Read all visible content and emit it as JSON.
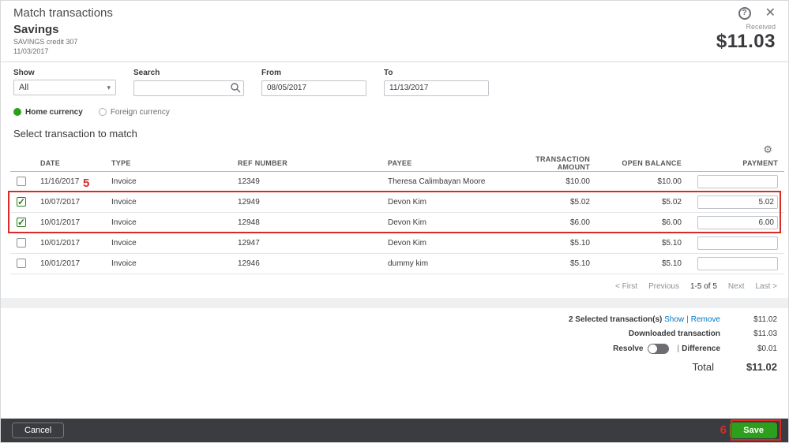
{
  "icons": {
    "help": "?",
    "close": "✕",
    "gear": "⚙",
    "caret": "▾"
  },
  "header": {
    "title": "Match transactions"
  },
  "account": {
    "name": "Savings",
    "subtitle": "SAVINGS credit 307",
    "date": "11/03/2017",
    "received_label": "Received",
    "received_amount": "$11.03"
  },
  "filters": {
    "show_label": "Show",
    "show_value": "All",
    "search_label": "Search",
    "search_value": "",
    "from_label": "From",
    "from_value": "08/05/2017",
    "to_label": "To",
    "to_value": "11/13/2017"
  },
  "currency": {
    "home_label": "Home currency",
    "foreign_label": "Foreign currency",
    "selected": "home"
  },
  "section_title": "Select transaction to match",
  "table": {
    "columns": [
      "DATE",
      "TYPE",
      "REF NUMBER",
      "PAYEE",
      "TRANSACTION AMOUNT",
      "OPEN BALANCE",
      "PAYMENT"
    ],
    "rows": [
      {
        "checked": false,
        "date": "11/16/2017",
        "type": "Invoice",
        "ref": "12349",
        "payee": "Theresa Calimbayan Moore",
        "amount": "$10.00",
        "open_balance": "$10.00",
        "payment": ""
      },
      {
        "checked": true,
        "date": "10/07/2017",
        "type": "Invoice",
        "ref": "12949",
        "payee": "Devon Kim",
        "amount": "$5.02",
        "open_balance": "$5.02",
        "payment": "5.02"
      },
      {
        "checked": true,
        "date": "10/01/2017",
        "type": "Invoice",
        "ref": "12948",
        "payee": "Devon Kim",
        "amount": "$6.00",
        "open_balance": "$6.00",
        "payment": "6.00"
      },
      {
        "checked": false,
        "date": "10/01/2017",
        "type": "Invoice",
        "ref": "12947",
        "payee": "Devon Kim",
        "amount": "$5.10",
        "open_balance": "$5.10",
        "payment": ""
      },
      {
        "checked": false,
        "date": "10/01/2017",
        "type": "Invoice",
        "ref": "12946",
        "payee": "dummy kim",
        "amount": "$5.10",
        "open_balance": "$5.10",
        "payment": ""
      }
    ]
  },
  "pagination": {
    "first": "< First",
    "previous": "Previous",
    "range": "1-5 of 5",
    "next": "Next",
    "last": "Last >"
  },
  "summary": {
    "selected_label": "2 Selected transaction(s)",
    "show_link": "Show",
    "remove_link": "Remove",
    "selected_amount": "$11.02",
    "downloaded_label": "Downloaded transaction",
    "downloaded_amount": "$11.03",
    "resolve_label": "Resolve",
    "difference_label": "Difference",
    "difference_amount": "$0.01",
    "total_label": "Total",
    "total_amount": "$11.02"
  },
  "footer": {
    "cancel": "Cancel",
    "save": "Save"
  },
  "annotations": {
    "step5": "5",
    "step6": "6"
  },
  "colors": {
    "accent_green": "#2ca01c",
    "link_blue": "#0077c5",
    "annotation_red": "#d92b25",
    "footer_bg": "#3b3c3f"
  }
}
